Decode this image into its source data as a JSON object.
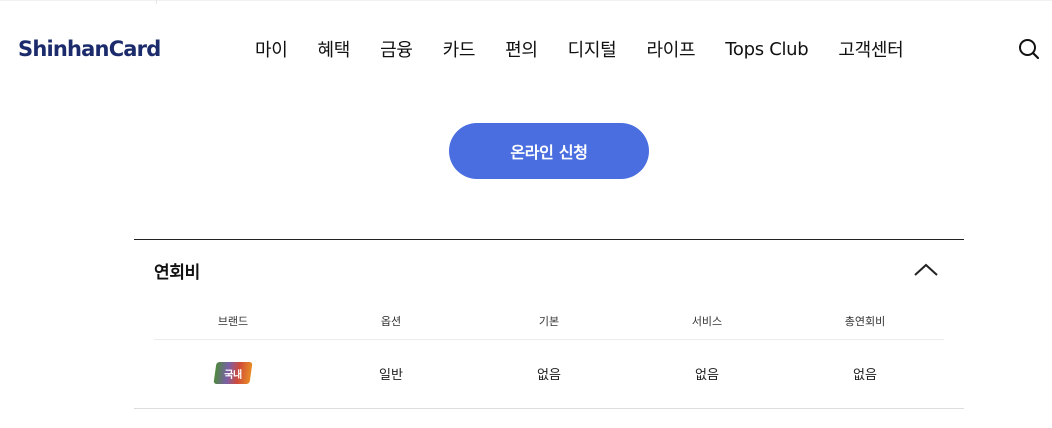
{
  "header": {
    "logo_text": "ShinhanCard",
    "nav": [
      "마이",
      "혜택",
      "금융",
      "카드",
      "편의",
      "디지털",
      "라이프",
      "Tops Club",
      "고객센터"
    ]
  },
  "apply_button": {
    "label": "온라인 신청"
  },
  "annual_fee": {
    "title": "연회비",
    "columns": [
      "브랜드",
      "옵션",
      "기본",
      "서비스",
      "총연회비"
    ],
    "rows": [
      {
        "brand_badge": "국내",
        "option": "일반",
        "basic": "없음",
        "service": "없음",
        "total": "없음"
      }
    ]
  },
  "colors": {
    "brand_navy": "#1c2b6b",
    "apply_button": "#4a6ee0"
  },
  "icons": {
    "search": "search-icon",
    "collapse": "chevron-up-icon"
  }
}
